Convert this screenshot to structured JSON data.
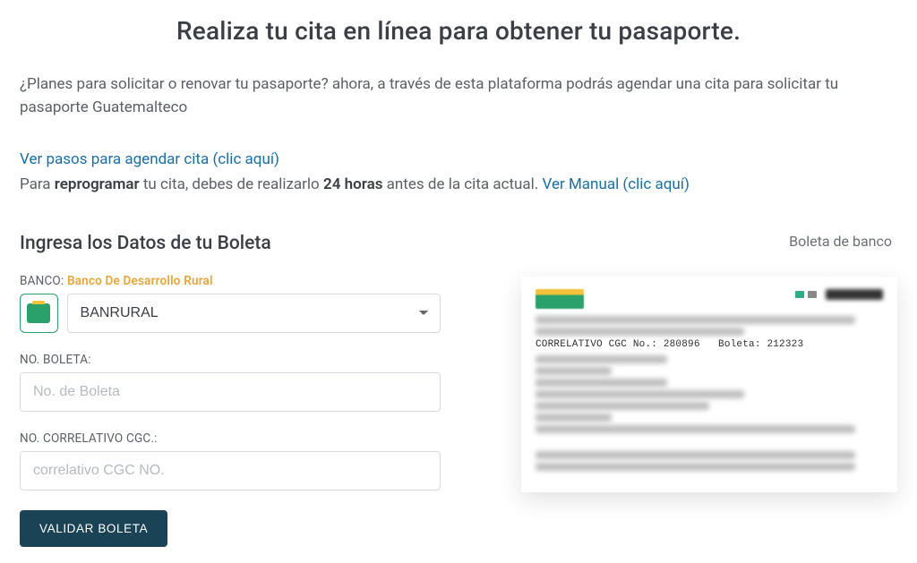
{
  "page": {
    "title": "Realiza tu cita en línea para obtener tu pasaporte.",
    "intro": "¿Planes para solicitar o renovar tu pasaporte? ahora, a través de esta plataforma podrás agendar una cita para solicitar tu pasaporte Guatemalteco"
  },
  "links": {
    "steps_link": "Ver pasos para agendar cita (clic aquí)",
    "repro_pre": "Para ",
    "repro_bold1": "reprogramar",
    "repro_mid": " tu cita, debes de realizarlo ",
    "repro_bold2": "24 horas",
    "repro_post": " antes de la cita actual. ",
    "manual_link": "Ver Manual (clic aquí)"
  },
  "form": {
    "section_title": "Ingresa los Datos de tu Boleta",
    "bank_label_prefix": "BANCO: ",
    "bank_name": "Banco De Desarrollo Rural",
    "bank_select_options": [
      "BANRURAL"
    ],
    "bank_selected": "BANRURAL",
    "boleta_label": "NO. BOLETA:",
    "boleta_placeholder": "No. de Boleta",
    "cgc_label": "NO. CORRELATIVO CGC.:",
    "cgc_placeholder": "correlativo CGC NO.",
    "validate_button": "VALIDAR BOLETA"
  },
  "right": {
    "title": "Boleta de banco",
    "receipt_clear_line": "CORRELATIVO CGC No.: 280896   Boleta: 212323"
  }
}
